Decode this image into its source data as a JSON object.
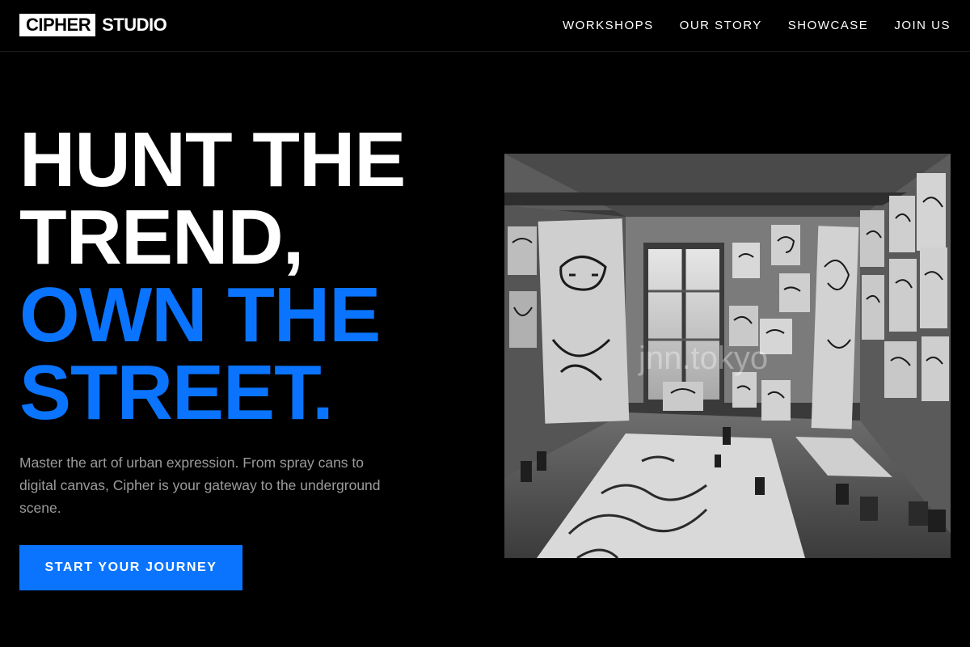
{
  "logo": {
    "boxed": "CIPHER",
    "text": "STUDIO"
  },
  "nav": {
    "items": [
      {
        "label": "WORKSHOPS"
      },
      {
        "label": "OUR STORY"
      },
      {
        "label": "SHOWCASE"
      },
      {
        "label": "JOIN US"
      }
    ]
  },
  "hero": {
    "title_lines": [
      "HUNT THE",
      "TREND,",
      "OWN THE",
      "STREET."
    ],
    "description": "Master the art of urban expression. From spray cans to digital canvas, Cipher is your gateway to the underground scene.",
    "cta_label": "START YOUR JOURNEY"
  },
  "image": {
    "watermark": "jnn.tokyo",
    "subject": "black and white photo of an art studio room covered with sketch drawings"
  },
  "colors": {
    "background": "#000000",
    "accent": "#0a74ff",
    "text": "#ffffff",
    "muted": "#9b9b9b"
  }
}
